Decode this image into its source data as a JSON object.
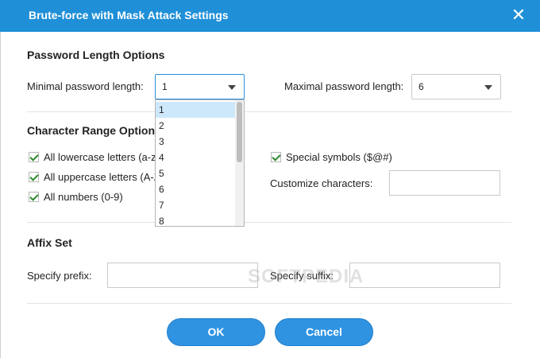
{
  "window": {
    "title": "Brute-force with Mask Attack Settings",
    "close_symbol": "✕"
  },
  "password_length": {
    "section_title": "Password Length Options",
    "min_label": "Minimal password length:",
    "min_value": "1",
    "max_label": "Maximal password length:",
    "max_value": "6",
    "dropdown_options": [
      "1",
      "2",
      "3",
      "4",
      "5",
      "6",
      "7",
      "8"
    ],
    "dropdown_selected": "1"
  },
  "character_range": {
    "section_title": "Character Range Options",
    "lowercase_label": "All lowercase letters (a-z)",
    "lowercase_checked": true,
    "uppercase_label": "All uppercase letters (A-Z)",
    "uppercase_checked": true,
    "numbers_label": "All numbers (0-9)",
    "numbers_checked": true,
    "special_label": "Special symbols ($@#)",
    "special_checked": true,
    "customize_label": "Customize characters:",
    "customize_value": ""
  },
  "affix": {
    "section_title": "Affix Set",
    "prefix_label": "Specify prefix:",
    "prefix_value": "",
    "suffix_label": "Specify suffix:",
    "suffix_value": ""
  },
  "watermark_text": "SOFTPEDIA",
  "buttons": {
    "ok": "OK",
    "cancel": "Cancel"
  },
  "colors": {
    "titlebar": "#1f8fd8",
    "button": "#2f93e2",
    "check": "#2e8b2e",
    "selected_item": "#cde8fb"
  }
}
